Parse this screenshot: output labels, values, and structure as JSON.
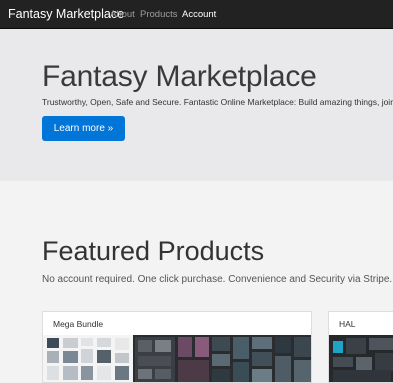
{
  "navbar": {
    "brand": "Fantasy Marketplace",
    "links": [
      {
        "label": "About"
      },
      {
        "label": "Products"
      },
      {
        "label": "Account"
      }
    ]
  },
  "hero": {
    "title": "Fantasy Marketplace",
    "subtitle": "Trustworthy, Open, Safe and Secure. Fantastic Online Marketplace: Build amazing things, join",
    "button_label": "Learn more »"
  },
  "featured": {
    "title": "Featured Products",
    "subtitle": "No account required. One click purchase. Convenience and Security via Stripe.",
    "products": [
      {
        "name": "Mega Bundle"
      },
      {
        "name": "HAL"
      }
    ]
  },
  "colors": {
    "navbar_bg": "#222222",
    "accent": "#0275d8",
    "jumbotron_bg": "#e9e9eb",
    "page_bg": "#f3f3f4"
  }
}
